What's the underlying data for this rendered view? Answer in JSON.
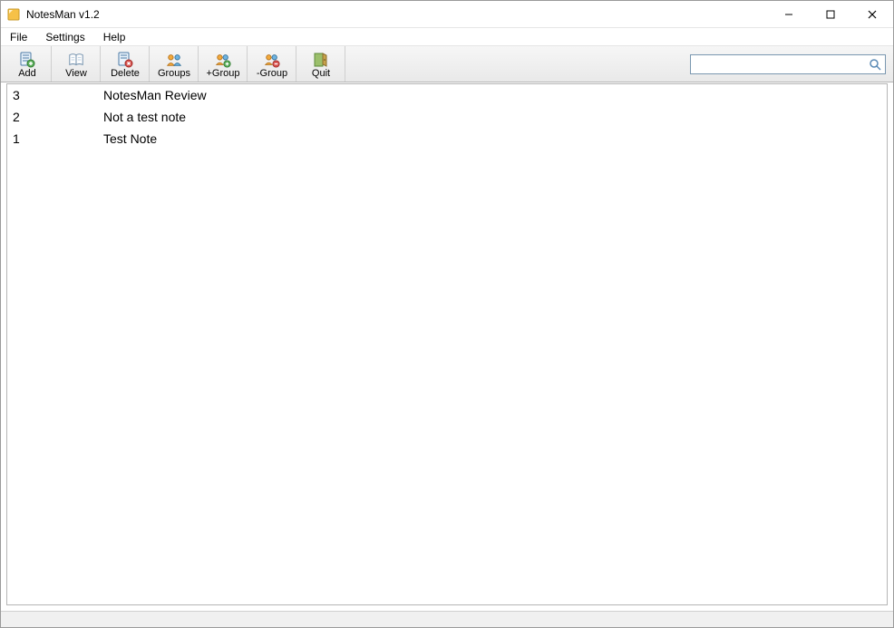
{
  "window": {
    "title": "NotesMan v1.2"
  },
  "menu": {
    "file": "File",
    "settings": "Settings",
    "help": "Help"
  },
  "toolbar": {
    "add": "Add",
    "view": "View",
    "delete": "Delete",
    "groups": "Groups",
    "add_group": "+Group",
    "remove_group": "-Group",
    "quit": "Quit"
  },
  "search": {
    "value": "",
    "placeholder": ""
  },
  "notes": [
    {
      "id": "3",
      "title": "NotesMan Review"
    },
    {
      "id": "2",
      "title": "Not a test note"
    },
    {
      "id": "1",
      "title": "Test Note"
    }
  ]
}
